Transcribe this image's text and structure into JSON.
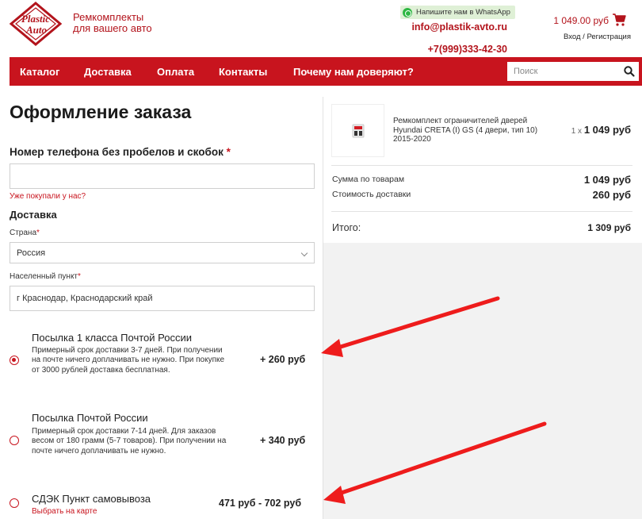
{
  "header": {
    "logo_text_1": "Plastic",
    "logo_text_2": "Auto",
    "tagline_1": "Ремкомплекты",
    "tagline_2": "для вашего авто",
    "whatsapp": "Напишите нам в WhatsApp",
    "email": "info@plastik-avto.ru",
    "phone": "+7(999)333-42-30",
    "cart_total": "1 049.00 руб",
    "login": "Вход / Регистрация"
  },
  "nav": {
    "items": [
      "Каталог",
      "Доставка",
      "Оплата",
      "Контакты",
      "Почему нам доверяют?"
    ],
    "search_placeholder": "Поиск"
  },
  "form": {
    "title": "Оформление заказа",
    "phone_label": "Номер телефона без пробелов и скобок",
    "required_mark": "*",
    "phone_value": "",
    "bought_link": "Уже покупали у нас?",
    "delivery_heading": "Доставка",
    "country_label": "Страна",
    "country_value": "Россия",
    "city_label": "Населенный пункт",
    "city_value": "г Краснодар, Краснодарский край",
    "options": [
      {
        "title": "Посылка 1 класса Почтой России",
        "desc": "Примерный срок доставки 3-7 дней. При получении на почте ничего доплачивать не нужно. При покупке от 3000 рублей доставка бесплатная.",
        "price": "+ 260 руб",
        "selected": true
      },
      {
        "title": "Посылка Почтой России",
        "desc": "Примерный срок доставки 7-14 дней. Для заказов весом от 180 грамм (5-7 товаров). При получении на почте ничего доплачивать не нужно.",
        "price": "+ 340 руб",
        "selected": false
      },
      {
        "title": "СДЭК Пункт самовывоза",
        "desc": "Выбрать на карте",
        "price": "471 руб - 702 руб",
        "selected": false
      }
    ]
  },
  "summary": {
    "product_name": "Ремкомплект ограничителей дверей Hyundai CRETA (I) GS (4 двери, тип 10) 2015-2020",
    "qty": "1 x",
    "price": "1 049 руб",
    "goods_label": "Сумма по товарам",
    "goods_value": "1 049 руб",
    "delivery_label": "Стоимость доставки",
    "delivery_value": "260 руб",
    "total_label": "Итого:",
    "total_value": "1 309 руб"
  },
  "colors": {
    "brand_red": "#c8141e",
    "arrow_red": "#ee1c1c",
    "panel_gray": "#f2f2f2"
  }
}
